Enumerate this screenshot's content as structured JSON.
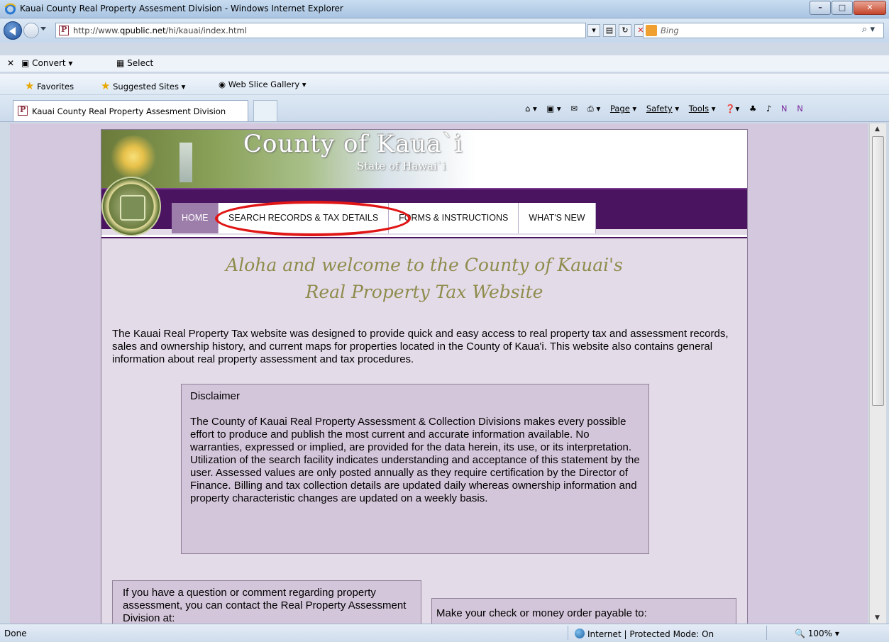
{
  "window": {
    "title": "Kauai County Real Property Assesment Division - Windows Internet Explorer"
  },
  "address": {
    "url_prefix": "http://www.",
    "url_domain": "qpublic.net",
    "url_path": "/hi/kauai/index.html",
    "search_placeholder": "Bing"
  },
  "commandbar": {
    "convert_label": "Convert",
    "select_label": "Select"
  },
  "favorites": {
    "favorites_label": "Favorites",
    "suggested_label": "Suggested Sites ▾",
    "webslice_label": "Web Slice Gallery ▾"
  },
  "tabs": {
    "active_label": "Kauai County Real Property Assesment Division",
    "page_label": "Page",
    "safety_label": "Safety",
    "tools_label": "Tools"
  },
  "site": {
    "county_title": "County of Kaua`i",
    "state_subtitle": "State of Hawai`i",
    "menu": [
      {
        "label": "HOME"
      },
      {
        "label": "SEARCH RECORDS & TAX DETAILS"
      },
      {
        "label": "FORMS & INSTRUCTIONS"
      },
      {
        "label": "WHAT'S NEW"
      }
    ],
    "welcome_line1": "Aloha and welcome to the County of Kauai's",
    "welcome_line2": "Real Property Tax Website",
    "intro": "The Kauai Real Property Tax website was designed to provide quick and easy access to real property tax and assessment records, sales and ownership history, and current maps for properties located in the County of Kaua'i.  This website also contains general information about real property assessment and tax procedures.",
    "disclaimer_heading": "Disclaimer",
    "disclaimer_text": "The County of Kauai Real Property Assessment & Collection Divisions makes every possible effort to produce and publish the most current and accurate information available. No warranties, expressed or implied, are provided for the data herein, its use, or its interpretation. Utilization of the search facility indicates understanding and acceptance of this statement by the user. Assessed values are only posted annually as they require certification by the Director of Finance. Billing and tax collection details are updated daily whereas ownership information and property characteristic changes are updated on a weekly basis.",
    "contact_text": "If you have a question or comment regarding property assessment, you can contact the Real Property Assessment Division at:",
    "payable_text": "Make your check or money order payable to:"
  },
  "status": {
    "left": "Done",
    "zone": "Internet | Protected Mode: On",
    "zoom": "100%"
  }
}
